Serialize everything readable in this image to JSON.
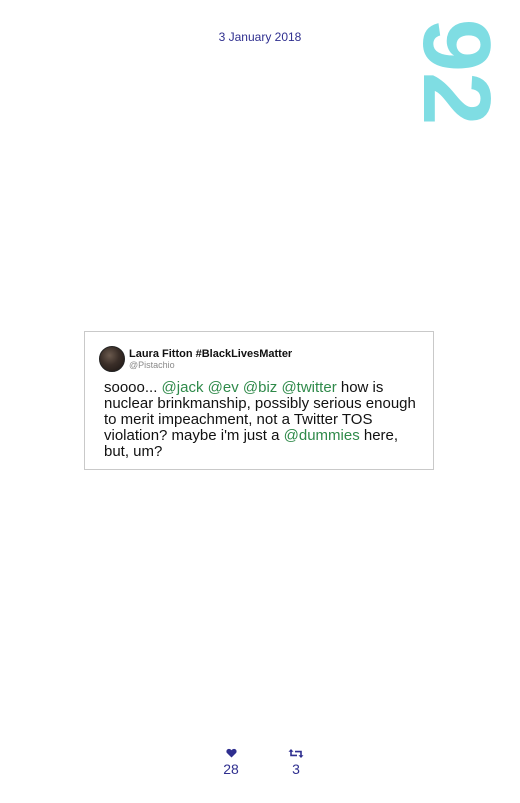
{
  "header": {
    "date": "3 January 2018",
    "page_number": "92"
  },
  "tweet": {
    "display_name": "Laura Fitton #BlackLivesMatter",
    "handle": "@Pistachio",
    "text_parts": [
      {
        "text": "soooo... ",
        "type": "plain"
      },
      {
        "text": "@jack",
        "type": "mention"
      },
      {
        "text": " ",
        "type": "plain"
      },
      {
        "text": "@ev",
        "type": "mention"
      },
      {
        "text": " ",
        "type": "plain"
      },
      {
        "text": "@biz",
        "type": "mention"
      },
      {
        "text": " ",
        "type": "plain"
      },
      {
        "text": "@twitter",
        "type": "mention"
      },
      {
        "text": " how is nuclear brinkmanship, possibly serious enough to merit impeachment, not a Twitter TOS violation? maybe i'm just a ",
        "type": "plain"
      },
      {
        "text": "@dummies",
        "type": "mention"
      },
      {
        "text": " here, but, um?",
        "type": "plain"
      }
    ]
  },
  "stats": {
    "likes": "28",
    "retweets": "3",
    "like_icon": "heart-icon",
    "retweet_icon": "retweet-icon"
  },
  "colors": {
    "date": "#2f2f8f",
    "page_number": "#7fdde3",
    "mention": "#2f8a4a"
  }
}
